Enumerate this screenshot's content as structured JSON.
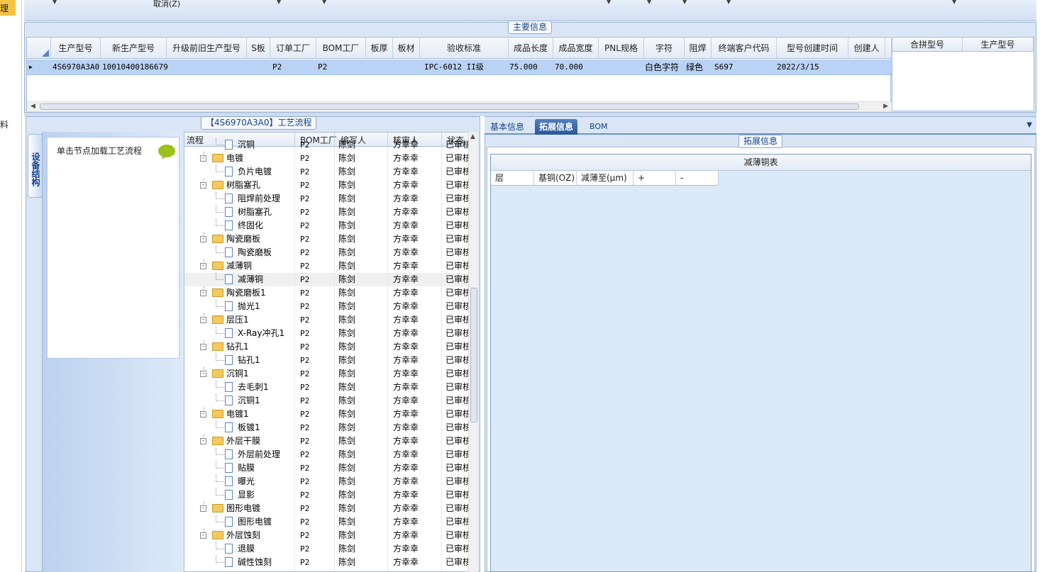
{
  "left_nav": {
    "item_top": "理",
    "item_mid": "料"
  },
  "toolbar": {
    "cancel_label": "取消(Z)"
  },
  "main_info": {
    "title": "主要信息",
    "columns": [
      "生产型号",
      "新生产型号",
      "升级前旧生产型号",
      "S板",
      "订单工厂",
      "BOM工厂",
      "板厚",
      "板材",
      "验收标准",
      "成品长度",
      "成品宽度",
      "PNL规格",
      "字符",
      "阻焊",
      "终端客户代码",
      "型号创建时间",
      "创建人"
    ],
    "row": {
      "prod_model": "4S6970A3A0",
      "new_model": "10010400186679",
      "old_model": "",
      "s_board": "",
      "order_factory": "P2",
      "bom_factory": "P2",
      "thickness": "",
      "material": "",
      "standard": "IPC-6012 II级",
      "length": "75.000",
      "width": "70.000",
      "pnl": "",
      "char": "白色字符",
      "solder": "绿色",
      "customer": "S697",
      "created": "2022/3/15",
      "creator": ""
    },
    "merge_columns": [
      "合拼型号",
      "生产型号"
    ]
  },
  "process": {
    "title": "【4S6970A3A0】工艺流程",
    "side_tab": "设备结构",
    "hint": "单击节点加载工艺流程",
    "headers": [
      "流程",
      "BOM工厂",
      "编写人",
      "核审人",
      "状态"
    ],
    "rows": [
      {
        "name": "沉铜",
        "level": 2,
        "bom": "P2",
        "writer": "陈剑",
        "reviewer": "方幸幸",
        "status": "已审核"
      },
      {
        "name": "电镀",
        "level": 1,
        "bom": "P2",
        "writer": "陈剑",
        "reviewer": "方幸幸",
        "status": "已审核"
      },
      {
        "name": "负片电镀",
        "level": 2,
        "bom": "P2",
        "writer": "陈剑",
        "reviewer": "方幸幸",
        "status": "已审核"
      },
      {
        "name": "树脂塞孔",
        "level": 1,
        "bom": "P2",
        "writer": "陈剑",
        "reviewer": "方幸幸",
        "status": "已审核"
      },
      {
        "name": "阻焊前处理",
        "level": 2,
        "bom": "P2",
        "writer": "陈剑",
        "reviewer": "方幸幸",
        "status": "已审核"
      },
      {
        "name": "树脂塞孔",
        "level": 2,
        "bom": "P2",
        "writer": "陈剑",
        "reviewer": "方幸幸",
        "status": "已审核"
      },
      {
        "name": "终固化",
        "level": 2,
        "bom": "P2",
        "writer": "陈剑",
        "reviewer": "方幸幸",
        "status": "已审核"
      },
      {
        "name": "陶瓷磨板",
        "level": 1,
        "bom": "P2",
        "writer": "陈剑",
        "reviewer": "方幸幸",
        "status": "已审核"
      },
      {
        "name": "陶瓷磨板",
        "level": 2,
        "bom": "P2",
        "writer": "陈剑",
        "reviewer": "方幸幸",
        "status": "已审核"
      },
      {
        "name": "减薄铜",
        "level": 1,
        "bom": "P2",
        "writer": "陈剑",
        "reviewer": "方幸幸",
        "status": "已审核"
      },
      {
        "name": "减薄铜",
        "level": 2,
        "bom": "P2",
        "writer": "陈剑",
        "reviewer": "方幸幸",
        "status": "已审核",
        "selected": true
      },
      {
        "name": "陶瓷磨板1",
        "level": 1,
        "bom": "P2",
        "writer": "陈剑",
        "reviewer": "方幸幸",
        "status": "已审核"
      },
      {
        "name": "抛光1",
        "level": 2,
        "bom": "P2",
        "writer": "陈剑",
        "reviewer": "方幸幸",
        "status": "已审核"
      },
      {
        "name": "层压1",
        "level": 1,
        "bom": "P2",
        "writer": "陈剑",
        "reviewer": "方幸幸",
        "status": "已审核"
      },
      {
        "name": "X-Ray冲孔1",
        "level": 2,
        "bom": "P2",
        "writer": "陈剑",
        "reviewer": "方幸幸",
        "status": "已审核"
      },
      {
        "name": "钻孔1",
        "level": 1,
        "bom": "P2",
        "writer": "陈剑",
        "reviewer": "方幸幸",
        "status": "已审核"
      },
      {
        "name": "钻孔1",
        "level": 2,
        "bom": "P2",
        "writer": "陈剑",
        "reviewer": "方幸幸",
        "status": "已审核"
      },
      {
        "name": "沉铜1",
        "level": 1,
        "bom": "P2",
        "writer": "陈剑",
        "reviewer": "方幸幸",
        "status": "已审核"
      },
      {
        "name": "去毛刺1",
        "level": 2,
        "bom": "P2",
        "writer": "陈剑",
        "reviewer": "方幸幸",
        "status": "已审核"
      },
      {
        "name": "沉铜1",
        "level": 2,
        "bom": "P2",
        "writer": "陈剑",
        "reviewer": "方幸幸",
        "status": "已审核"
      },
      {
        "name": "电镀1",
        "level": 1,
        "bom": "P2",
        "writer": "陈剑",
        "reviewer": "方幸幸",
        "status": "已审核"
      },
      {
        "name": "板镀1",
        "level": 2,
        "bom": "P2",
        "writer": "陈剑",
        "reviewer": "方幸幸",
        "status": "已审核"
      },
      {
        "name": "外层干膜",
        "level": 1,
        "bom": "P2",
        "writer": "陈剑",
        "reviewer": "方幸幸",
        "status": "已审核"
      },
      {
        "name": "外层前处理",
        "level": 2,
        "bom": "P2",
        "writer": "陈剑",
        "reviewer": "方幸幸",
        "status": "已审核"
      },
      {
        "name": "贴膜",
        "level": 2,
        "bom": "P2",
        "writer": "陈剑",
        "reviewer": "方幸幸",
        "status": "已审核"
      },
      {
        "name": "曝光",
        "level": 2,
        "bom": "P2",
        "writer": "陈剑",
        "reviewer": "方幸幸",
        "status": "已审核"
      },
      {
        "name": "显影",
        "level": 2,
        "bom": "P2",
        "writer": "陈剑",
        "reviewer": "方幸幸",
        "status": "已审核"
      },
      {
        "name": "图形电镀",
        "level": 1,
        "bom": "P2",
        "writer": "陈剑",
        "reviewer": "方幸幸",
        "status": "已审核"
      },
      {
        "name": "图形电镀",
        "level": 2,
        "bom": "P2",
        "writer": "陈剑",
        "reviewer": "方幸幸",
        "status": "已审核"
      },
      {
        "name": "外层蚀刻",
        "level": 1,
        "bom": "P2",
        "writer": "陈剑",
        "reviewer": "方幸幸",
        "status": "已审核"
      },
      {
        "name": "退膜",
        "level": 2,
        "bom": "P2",
        "writer": "陈剑",
        "reviewer": "方幸幸",
        "status": "已审核"
      },
      {
        "name": "碱性蚀刻",
        "level": 2,
        "bom": "P2",
        "writer": "陈剑",
        "reviewer": "方幸幸",
        "status": "已审核"
      }
    ]
  },
  "right_tabs": {
    "basic": "基本信息",
    "expand": "拓展信息",
    "bom": "BOM"
  },
  "expand": {
    "group_title": "拓展信息",
    "table_title": "减薄铜表",
    "columns": [
      "层",
      "基铜(OZ)",
      "减薄至(μm)",
      "+",
      "-"
    ]
  }
}
